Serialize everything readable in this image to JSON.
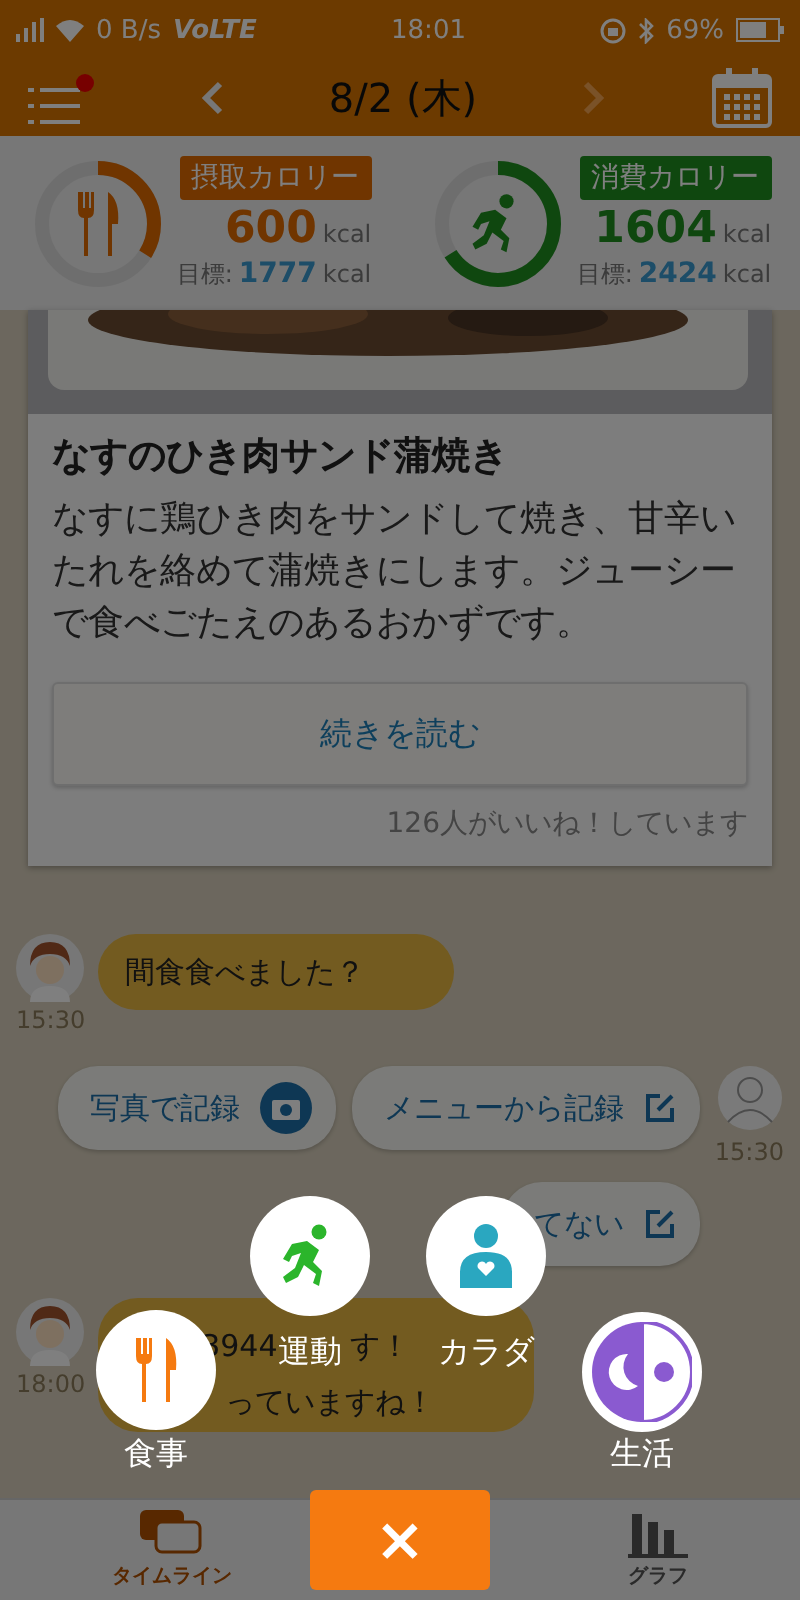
{
  "status_bar": {
    "network": "0 B/s",
    "volte": "VoLTE",
    "time": "18:01",
    "battery": "69%"
  },
  "header": {
    "date": "8/2 (木)",
    "menu_badge": true
  },
  "calories": [
    {
      "kind": "intake",
      "label": "摂取カロリー",
      "value": "600",
      "unit": "kcal",
      "goal_label": "目標:",
      "goal": "1777",
      "goal_unit": "kcal",
      "level": 0.34
    },
    {
      "kind": "burn",
      "label": "消費カロリー",
      "value": "1604",
      "unit": "kcal",
      "goal_label": "目標:",
      "goal": "2424",
      "goal_unit": "kcal",
      "level": 0.66
    }
  ],
  "card": {
    "title": "なすのひき肉サンド蒲焼き",
    "description": "なすに鶏ひき肉をサンドして焼き、甘辛いたれを絡めて蒲焼きにします。ジューシーで食べごたえのあるおかずです。",
    "button": "続きを読む",
    "likes": "126人がいいね！しています"
  },
  "chat": [
    {
      "kind": "bot",
      "lines": [
        [
          "間食食べました？"
        ]
      ],
      "time": "15:30"
    },
    {
      "kind": "choices",
      "buttons": [
        {
          "label": "写真で記録"
        },
        {
          "label": "メニューから記録",
          "kind": "edit"
        }
      ],
      "time": "15:30"
    },
    {
      "kind": "choices",
      "buttons": [
        {
          "label": "てない",
          "kind": "edit"
        }
      ]
    },
    {
      "kind": "bot",
      "lines": [
        [
          "3944",
          "す！"
        ],
        [
          "っていますね！"
        ]
      ],
      "time": "18:00"
    }
  ],
  "menu": [
    {
      "kind": "meal",
      "label": "食事"
    },
    {
      "kind": "exercise",
      "label": "運動"
    },
    {
      "kind": "body",
      "label": "カラダ"
    },
    {
      "kind": "life",
      "label": "生活"
    }
  ],
  "close": "×",
  "nav": [
    {
      "label": "タイムライン",
      "selected": true
    },
    {
      "label": "グラフ",
      "selected": false
    }
  ]
}
